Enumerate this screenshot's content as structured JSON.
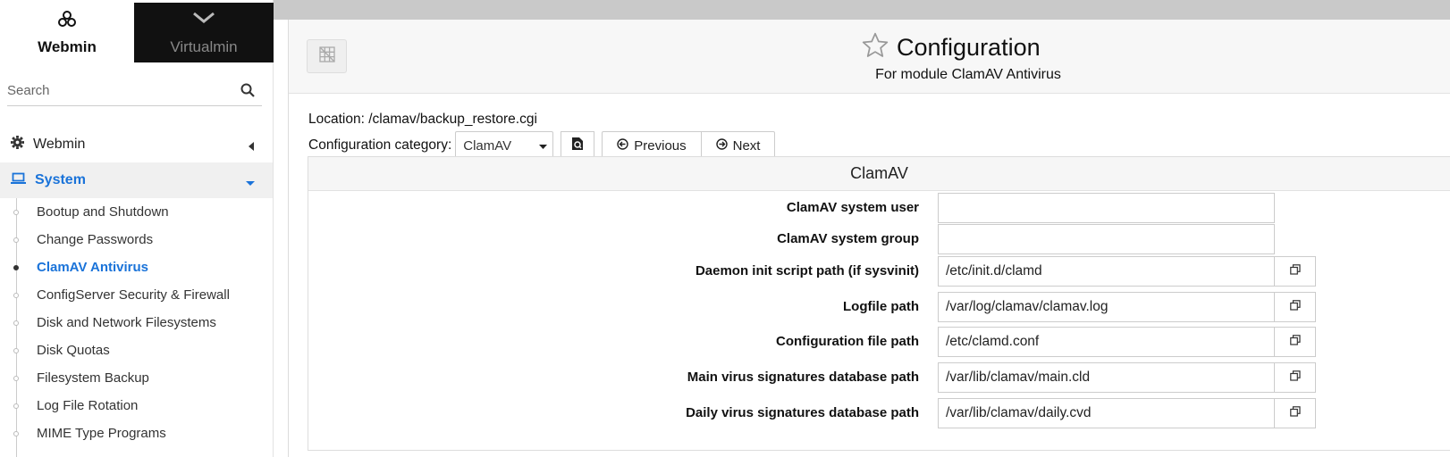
{
  "sidebar": {
    "switch": {
      "webmin": "Webmin",
      "virtualmin": "Virtualmin"
    },
    "search_placeholder": "Search",
    "sections": {
      "webmin": "Webmin",
      "system": "System"
    },
    "items": [
      "Bootup and Shutdown",
      "Change Passwords",
      "ClamAV Antivirus",
      "ConfigServer Security & Firewall",
      "Disk and Network Filesystems",
      "Disk Quotas",
      "Filesystem Backup",
      "Log File Rotation",
      "MIME Type Programs"
    ],
    "active_item": "ClamAV Antivirus"
  },
  "header": {
    "title": "Configuration",
    "subtitle": "For module ClamAV Antivirus"
  },
  "location": "Location: /clamav/backup_restore.cgi",
  "category": {
    "label": "Configuration category:",
    "selected": "ClamAV",
    "previous": "Previous",
    "next": "Next"
  },
  "panel": {
    "title": "ClamAV",
    "fields": [
      {
        "label": "ClamAV system user",
        "value": "",
        "has_button": false
      },
      {
        "label": "ClamAV system group",
        "value": "",
        "has_button": false
      },
      {
        "label": "Daemon init script path (if sysvinit)",
        "value": "/etc/init.d/clamd",
        "has_button": true
      },
      {
        "label": "Logfile path",
        "value": "/var/log/clamav/clamav.log",
        "has_button": true
      },
      {
        "label": "Configuration file path",
        "value": "/etc/clamd.conf",
        "has_button": true
      },
      {
        "label": "Main virus signatures database path",
        "value": "/var/lib/clamav/main.cld",
        "has_button": true
      },
      {
        "label": "Daily virus signatures database path",
        "value": "/var/lib/clamav/daily.cvd",
        "has_button": true
      }
    ]
  },
  "colors": {
    "accent": "#1a73d9",
    "dark": "#111111"
  }
}
